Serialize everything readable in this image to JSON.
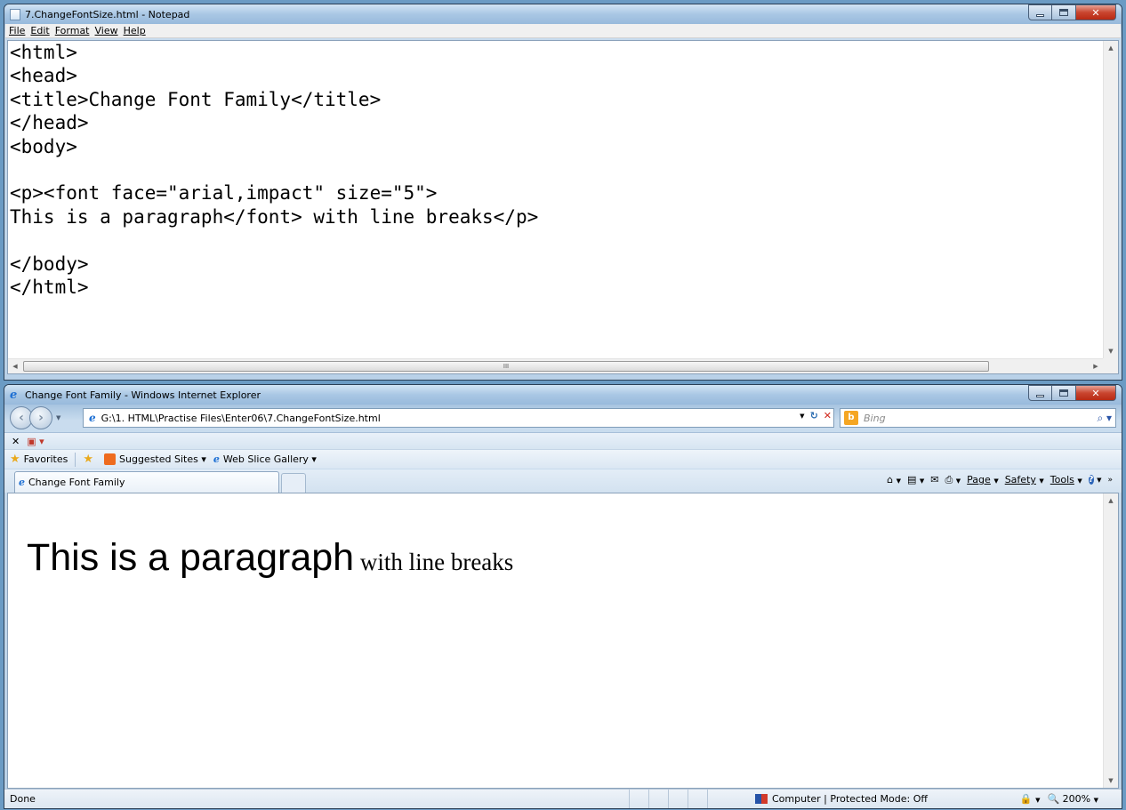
{
  "notepad": {
    "title": "7.ChangeFontSize.html - Notepad",
    "menu": [
      "File",
      "Edit",
      "Format",
      "View",
      "Help"
    ],
    "code_lines": [
      "<html>",
      "<head>",
      "<title>Change Font Family</title>",
      "</head>",
      "<body>",
      "",
      "<p><font face=\"arial,impact\" size=\"5\">",
      "This is a paragraph</font> with line breaks</p>",
      "",
      "</body>",
      "</html>"
    ],
    "hscroll_grip": "III"
  },
  "ie": {
    "title": "Change Font Family - Windows Internet Explorer",
    "address": "G:\\1. HTML\\Practise Files\\Enter06\\7.ChangeFontSize.html",
    "search_placeholder": "Bing",
    "favorites_label": "Favorites",
    "favbar_items": [
      "Suggested Sites ▾",
      "Web Slice Gallery ▾"
    ],
    "tab_title": "Change Font Family",
    "tools": {
      "page": "Page",
      "safety": "Safety",
      "tools": "Tools"
    },
    "content": {
      "big_text": "This is a paragraph",
      "small_text": " with line breaks"
    },
    "status": {
      "left": "Done",
      "zone": "Computer | Protected Mode: Off",
      "zoom": "200%"
    }
  }
}
